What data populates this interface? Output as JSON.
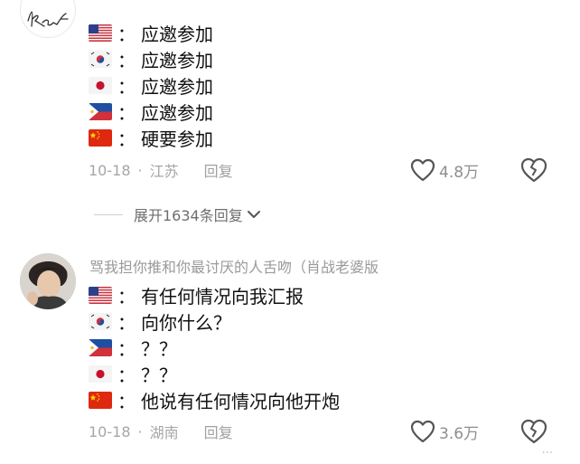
{
  "comments": [
    {
      "username": "",
      "lines": [
        {
          "flag": "us-flag",
          "text": "应邀参加"
        },
        {
          "flag": "kr-flag",
          "text": "应邀参加"
        },
        {
          "flag": "jp-flag",
          "text": "应邀参加"
        },
        {
          "flag": "ph-flag",
          "text": "应邀参加"
        },
        {
          "flag": "cn-flag",
          "text": "硬要参加"
        }
      ],
      "date": "10-18",
      "separator": "·",
      "location": "江苏",
      "reply_label": "回复",
      "likes": "4.8万",
      "expand_label": "展开1634条回复"
    },
    {
      "username": "骂我担你推和你最讨厌的人舌吻（肖战老婆版",
      "lines": [
        {
          "flag": "us-flag",
          "text": "有任何情况向我汇报"
        },
        {
          "flag": "kr-flag",
          "text": "向你什么？"
        },
        {
          "flag": "ph-flag",
          "text": "？？"
        },
        {
          "flag": "jp-flag",
          "text": "？？"
        },
        {
          "flag": "cn-flag",
          "text": "他说有任何情况向他开炮"
        }
      ],
      "date": "10-18",
      "separator": "·",
      "location": "湖南",
      "reply_label": "回复",
      "likes": "3.6万"
    }
  ],
  "colon": "：",
  "watermark": "..."
}
